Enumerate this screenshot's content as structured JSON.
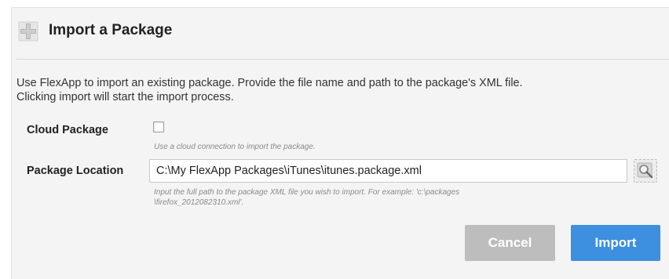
{
  "dialog": {
    "title": "Import a Package",
    "header_icon": "package-plus-icon",
    "description_lines": [
      "Use FlexApp to import an existing package. Provide the file name and path to the package's XML file.",
      "Clicking import will start the import process."
    ]
  },
  "cloud_package": {
    "label": "Cloud Package",
    "checked": false,
    "hint": "Use a cloud connection to import the package."
  },
  "package_location": {
    "label": "Package Location",
    "value": "C:\\My FlexApp Packages\\iTunes\\itunes.package.xml",
    "hint_lines": [
      "Input the full path to the package XML file you wish to import. For example: 'c:\\packages",
      "\\firefox_2012082310.xml'."
    ],
    "browse_icon": "browse-search-icon"
  },
  "buttons": {
    "cancel_label": "Cancel",
    "import_label": "Import"
  },
  "colors": {
    "import_button": "#3d8fdf",
    "cancel_button": "#bdbdbd",
    "dialog_background": "#f4f4f4"
  }
}
